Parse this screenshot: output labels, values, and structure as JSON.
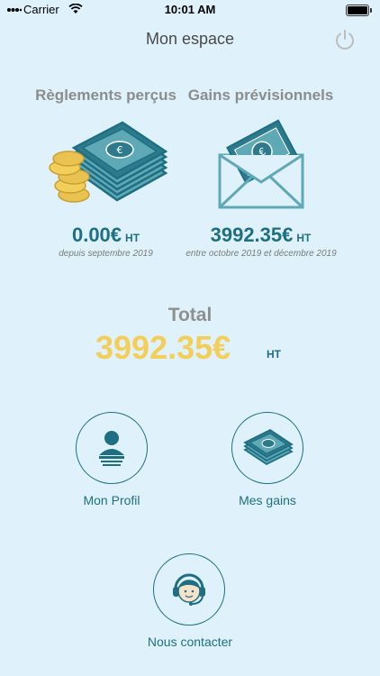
{
  "status_bar": {
    "carrier": "Carrier",
    "time": "10:01 AM"
  },
  "header": {
    "title": "Mon espace"
  },
  "summary": {
    "received": {
      "label": "Règlements perçus",
      "amount": "0.00€",
      "unit": "HT",
      "period": "depuis septembre 2019"
    },
    "forecast": {
      "label": "Gains prévisionnels",
      "amount": "3992.35€",
      "unit": "HT",
      "period": "entre octobre 2019 et décembre 2019"
    }
  },
  "total": {
    "label": "Total",
    "amount": "3992.35€",
    "unit": "HT"
  },
  "actions": {
    "profile": {
      "label": "Mon Profil",
      "icon": "profile-icon"
    },
    "earnings": {
      "label": "Mes gains",
      "icon": "money-stack-icon"
    },
    "contact": {
      "label": "Nous contacter",
      "icon": "support-headset-icon"
    }
  },
  "colors": {
    "background": "#dff2fb",
    "primary": "#1e6f83",
    "accent": "#f3cf5a",
    "muted": "#8c8c8c"
  }
}
